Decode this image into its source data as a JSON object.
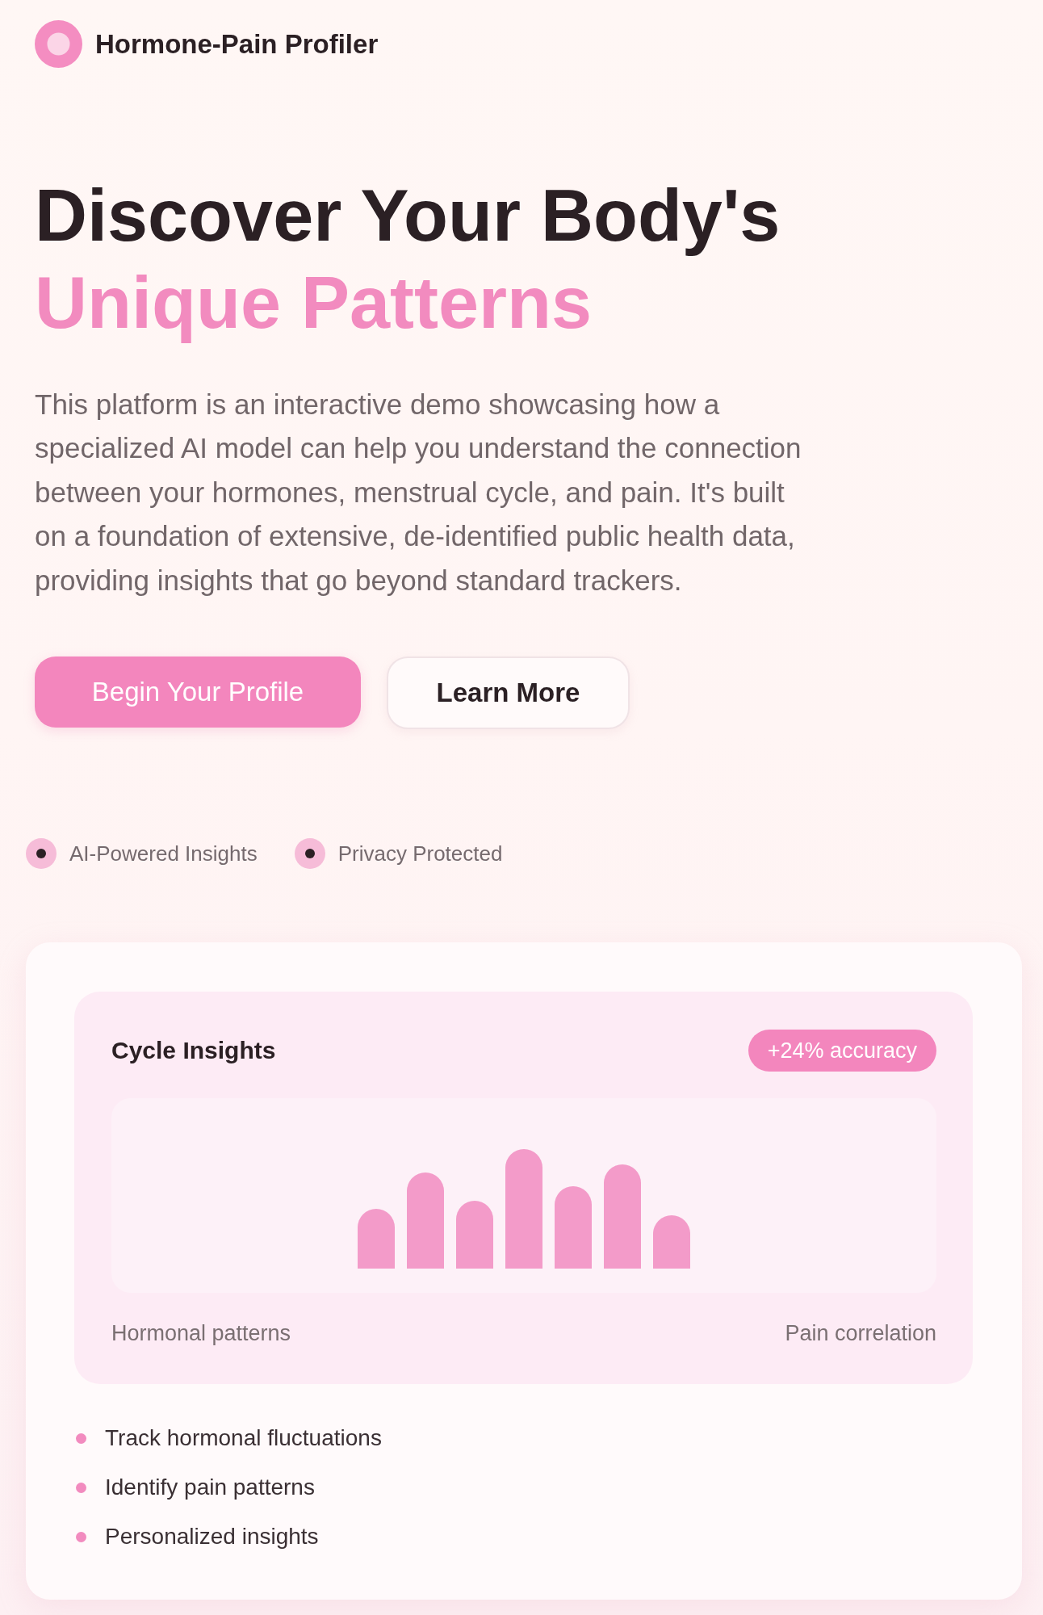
{
  "header": {
    "brand": "Hormone-Pain Profiler"
  },
  "hero": {
    "title": "Discover Your Body's",
    "title_highlight": "Unique Patterns",
    "description": "This platform is an interactive demo showcasing how a specialized AI model can help you understand the connection between your hormones, menstrual cycle, and pain. It's built on a foundation of extensive, de-identified public health data, providing insights that go beyond standard trackers.",
    "buttons": [
      {
        "label": "Begin Your Profile",
        "kind": "primary"
      },
      {
        "label": "Learn More",
        "kind": "secondary"
      }
    ]
  },
  "features": [
    "AI-Powered Insights",
    "Privacy Protected"
  ],
  "insights_card": {
    "title": "Cycle Insights",
    "badge": "+24% accuracy",
    "chart_labels": [
      "Hormonal patterns",
      "Pain correlation"
    ],
    "points": [
      "Track hormonal fluctuations",
      "Identify pain patterns",
      "Personalized insights"
    ]
  }
}
